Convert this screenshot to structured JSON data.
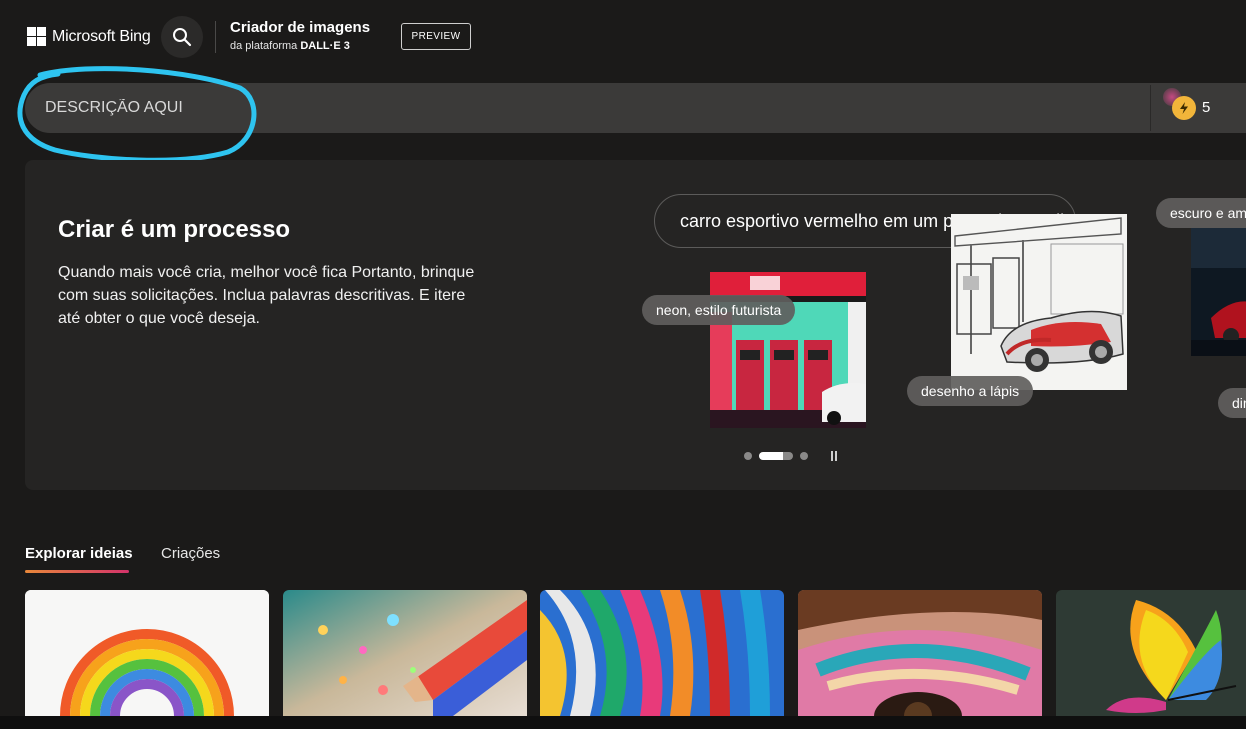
{
  "header": {
    "brand": "Microsoft Bing",
    "app_title": "Criador de imagens",
    "app_subtitle_prefix": "da plataforma",
    "app_subtitle_engine": "DALL·E 3",
    "preview_badge": "PREVIEW"
  },
  "prompt_bar": {
    "value": "DESCRIÇÃO AQUI",
    "boosts": "5"
  },
  "hero": {
    "title": "Criar é um processo",
    "description": "Quando mais você cria, melhor você fica Portanto, brinque com suas solicitações. Inclua palavras descritivas. E itere até obter o que você deseja.",
    "prompt_text": "carro esportivo vermelho em um posto de gasolina",
    "tags": [
      "neon, estilo futurista",
      "desenho a lápis",
      "escuro e am",
      "dir"
    ],
    "carousel_active_index": 1
  },
  "tabs": [
    {
      "label": "Explorar ideias",
      "active": true
    },
    {
      "label": "Criações",
      "active": false
    }
  ],
  "colors": {
    "background": "#1b1a19",
    "panel": "#252423",
    "prompt_bar": "#3b3a39",
    "annotation": "#2ec4f0",
    "tab_underline": "#e8883a"
  },
  "icons": [
    "microsoft-logo-icon",
    "search-icon",
    "boost-icon",
    "pause-icon"
  ]
}
